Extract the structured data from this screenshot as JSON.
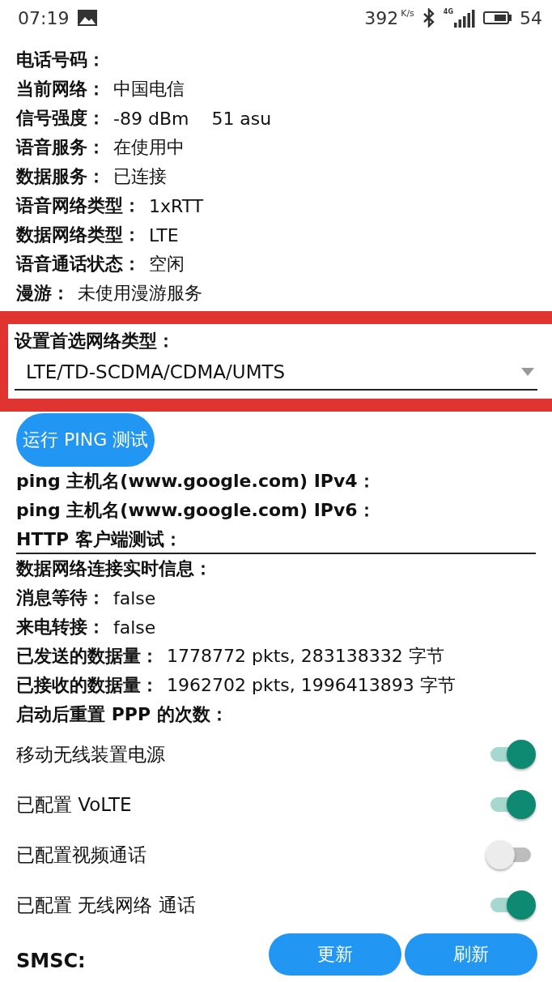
{
  "status_bar": {
    "time": "07:19",
    "speed": "392",
    "speed_unit": "K/s",
    "network": "4G",
    "battery": "54"
  },
  "info_rows": [
    {
      "label": "电话号码：",
      "value": ""
    },
    {
      "label": "当前网络：",
      "value": "中国电信"
    },
    {
      "label": "信号强度：",
      "value": "-89 dBm    51 asu"
    },
    {
      "label": "语音服务：",
      "value": "在使用中"
    },
    {
      "label": "数据服务：",
      "value": "已连接"
    },
    {
      "label": "语音网络类型：",
      "value": "1xRTT"
    },
    {
      "label": "数据网络类型：",
      "value": "LTE"
    },
    {
      "label": "语音通话状态：",
      "value": "空闲"
    },
    {
      "label": "漫游：",
      "value": "未使用漫游服务"
    }
  ],
  "preferred_network": {
    "label": "设置首选网络类型：",
    "value": "LTE/TD-SCDMA/CDMA/UMTS"
  },
  "ping_button": "运行 PING 测试",
  "test_rows": [
    {
      "label": "ping 主机名(www.google.com) IPv4：",
      "value": ""
    },
    {
      "label": "ping 主机名(www.google.com) IPv6：",
      "value": ""
    },
    {
      "label": "HTTP 客户端测试：",
      "value": "",
      "underlined": true
    },
    {
      "label": "数据网络连接实时信息：",
      "value": ""
    },
    {
      "label": "消息等待：",
      "value": "false"
    },
    {
      "label": "来电转接：",
      "value": "false"
    },
    {
      "label": "已发送的数据量：",
      "value": "1778772 pkts, 283138332 字节"
    },
    {
      "label": "已接收的数据量：",
      "value": "1962702 pkts, 1996413893 字节"
    },
    {
      "label": "启动后重置 PPP 的次数：",
      "value": ""
    }
  ],
  "switches": [
    {
      "label": "移动无线装置电源",
      "on": true
    },
    {
      "label": "已配置 VoLTE",
      "on": true
    },
    {
      "label": "已配置视频通话",
      "on": false
    },
    {
      "label": "已配置 无线网络 通话",
      "on": true
    }
  ],
  "smsc_label": "SMSC:",
  "buttons": [
    "更新",
    "刷新"
  ]
}
